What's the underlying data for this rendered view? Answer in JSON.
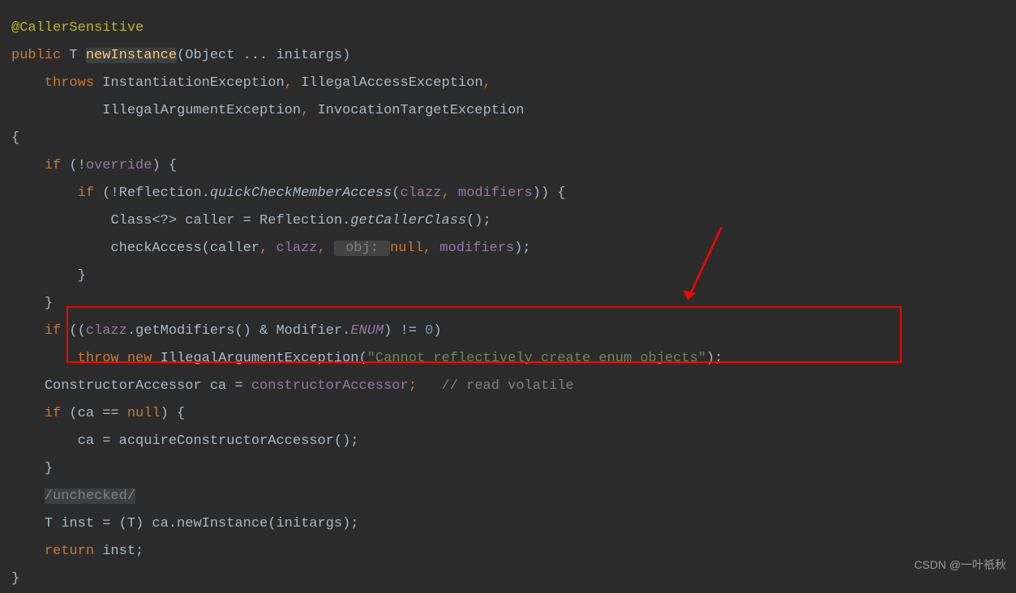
{
  "code": {
    "annotation": "@CallerSensitive",
    "public": "public",
    "T": "T",
    "newInstance": "newInstance",
    "params": "(Object ... initargs)",
    "throws": "throws",
    "exceptions1": "InstantiationException",
    "comma1": ", ",
    "exceptions2": "IllegalAccessException",
    "comma2": ",",
    "exceptions3": "IllegalArgumentException",
    "comma3": ", ",
    "exceptions4": "InvocationTargetException",
    "openBrace": "{",
    "if1": "if",
    "not": "(!",
    "override": "override",
    "closeCond1": ") {",
    "if2": "if",
    "notRefl": "(!Reflection.",
    "quickCheck": "quickCheckMemberAccess",
    "openParen2": "(",
    "clazz1": "clazz",
    "commaSpace": ", ",
    "modifiers1": "modifiers",
    "closeCond2": ")) {",
    "classDecl": "Class<?> caller = Reflection.",
    "getCallerClass": "getCallerClass",
    "parens": "();",
    "checkAccess": "checkAccess(caller",
    "comma4": ", ",
    "clazz2": "clazz",
    "comma5": ", ",
    "objHint": " obj: ",
    "nullKw": "null",
    "comma6": ", ",
    "modifiers2": "modifiers",
    "semi1": ");",
    "closeBrace1": "}",
    "closeBrace2": "}",
    "if3": "if",
    "openCond3": " ((",
    "clazz3": "clazz",
    "dotGetMod": ".getModifiers() & Modifier.",
    "enum": "ENUM",
    "neZero": ") != ",
    "zero": "0",
    "closeCond3": ")",
    "throw": "throw",
    "new1": "new",
    "illegalArg": "IllegalArgumentException(",
    "errMsg": "\"Cannot reflectively create enum objects\"",
    "semi2": ");",
    "constAcc": "ConstructorAccessor ca = ",
    "constAccField": "constructorAccessor",
    "semi3": ";",
    "readVolatile": "   // read volatile",
    "if4": "if",
    "caNull": " (ca == ",
    "null2": "null",
    "closeCond4": ") {",
    "caAssign": "ca = acquireConstructorAccessor();",
    "closeBrace3": "}",
    "unchecked": "/unchecked/",
    "tInst": "T inst = (T) ca.newInstance(initargs);",
    "return": "return",
    "instSemi": " inst;",
    "closeBrace4": "}"
  },
  "watermark": "CSDN @一叶祇秋"
}
